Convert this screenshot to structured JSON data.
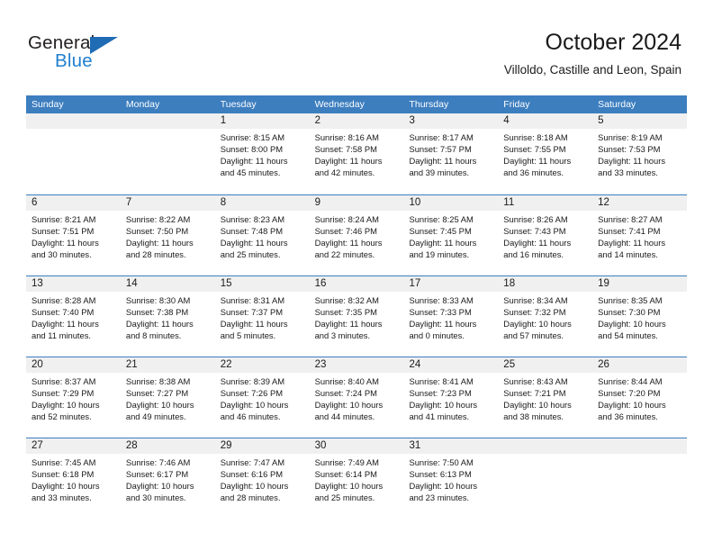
{
  "brand": {
    "name_top": "General",
    "name_bottom": "Blue",
    "triangle_color": "#1f6cb5",
    "blue_color": "#1f7fd0"
  },
  "header": {
    "title": "October 2024",
    "subtitle": "Villoldo, Castille and Leon, Spain"
  },
  "theme": {
    "header_blue": "#3d7ebf",
    "daynum_gray": "#f0f0f0",
    "text": "#1a1a1a"
  },
  "weekdays": [
    "Sunday",
    "Monday",
    "Tuesday",
    "Wednesday",
    "Thursday",
    "Friday",
    "Saturday"
  ],
  "weeks": [
    [
      {
        "day": "",
        "sunrise": "",
        "sunset": "",
        "daylight_line1": "",
        "daylight_line2": ""
      },
      {
        "day": "",
        "sunrise": "",
        "sunset": "",
        "daylight_line1": "",
        "daylight_line2": ""
      },
      {
        "day": "1",
        "sunrise": "Sunrise: 8:15 AM",
        "sunset": "Sunset: 8:00 PM",
        "daylight_line1": "Daylight: 11 hours",
        "daylight_line2": "and 45 minutes."
      },
      {
        "day": "2",
        "sunrise": "Sunrise: 8:16 AM",
        "sunset": "Sunset: 7:58 PM",
        "daylight_line1": "Daylight: 11 hours",
        "daylight_line2": "and 42 minutes."
      },
      {
        "day": "3",
        "sunrise": "Sunrise: 8:17 AM",
        "sunset": "Sunset: 7:57 PM",
        "daylight_line1": "Daylight: 11 hours",
        "daylight_line2": "and 39 minutes."
      },
      {
        "day": "4",
        "sunrise": "Sunrise: 8:18 AM",
        "sunset": "Sunset: 7:55 PM",
        "daylight_line1": "Daylight: 11 hours",
        "daylight_line2": "and 36 minutes."
      },
      {
        "day": "5",
        "sunrise": "Sunrise: 8:19 AM",
        "sunset": "Sunset: 7:53 PM",
        "daylight_line1": "Daylight: 11 hours",
        "daylight_line2": "and 33 minutes."
      }
    ],
    [
      {
        "day": "6",
        "sunrise": "Sunrise: 8:21 AM",
        "sunset": "Sunset: 7:51 PM",
        "daylight_line1": "Daylight: 11 hours",
        "daylight_line2": "and 30 minutes."
      },
      {
        "day": "7",
        "sunrise": "Sunrise: 8:22 AM",
        "sunset": "Sunset: 7:50 PM",
        "daylight_line1": "Daylight: 11 hours",
        "daylight_line2": "and 28 minutes."
      },
      {
        "day": "8",
        "sunrise": "Sunrise: 8:23 AM",
        "sunset": "Sunset: 7:48 PM",
        "daylight_line1": "Daylight: 11 hours",
        "daylight_line2": "and 25 minutes."
      },
      {
        "day": "9",
        "sunrise": "Sunrise: 8:24 AM",
        "sunset": "Sunset: 7:46 PM",
        "daylight_line1": "Daylight: 11 hours",
        "daylight_line2": "and 22 minutes."
      },
      {
        "day": "10",
        "sunrise": "Sunrise: 8:25 AM",
        "sunset": "Sunset: 7:45 PM",
        "daylight_line1": "Daylight: 11 hours",
        "daylight_line2": "and 19 minutes."
      },
      {
        "day": "11",
        "sunrise": "Sunrise: 8:26 AM",
        "sunset": "Sunset: 7:43 PM",
        "daylight_line1": "Daylight: 11 hours",
        "daylight_line2": "and 16 minutes."
      },
      {
        "day": "12",
        "sunrise": "Sunrise: 8:27 AM",
        "sunset": "Sunset: 7:41 PM",
        "daylight_line1": "Daylight: 11 hours",
        "daylight_line2": "and 14 minutes."
      }
    ],
    [
      {
        "day": "13",
        "sunrise": "Sunrise: 8:28 AM",
        "sunset": "Sunset: 7:40 PM",
        "daylight_line1": "Daylight: 11 hours",
        "daylight_line2": "and 11 minutes."
      },
      {
        "day": "14",
        "sunrise": "Sunrise: 8:30 AM",
        "sunset": "Sunset: 7:38 PM",
        "daylight_line1": "Daylight: 11 hours",
        "daylight_line2": "and 8 minutes."
      },
      {
        "day": "15",
        "sunrise": "Sunrise: 8:31 AM",
        "sunset": "Sunset: 7:37 PM",
        "daylight_line1": "Daylight: 11 hours",
        "daylight_line2": "and 5 minutes."
      },
      {
        "day": "16",
        "sunrise": "Sunrise: 8:32 AM",
        "sunset": "Sunset: 7:35 PM",
        "daylight_line1": "Daylight: 11 hours",
        "daylight_line2": "and 3 minutes."
      },
      {
        "day": "17",
        "sunrise": "Sunrise: 8:33 AM",
        "sunset": "Sunset: 7:33 PM",
        "daylight_line1": "Daylight: 11 hours",
        "daylight_line2": "and 0 minutes."
      },
      {
        "day": "18",
        "sunrise": "Sunrise: 8:34 AM",
        "sunset": "Sunset: 7:32 PM",
        "daylight_line1": "Daylight: 10 hours",
        "daylight_line2": "and 57 minutes."
      },
      {
        "day": "19",
        "sunrise": "Sunrise: 8:35 AM",
        "sunset": "Sunset: 7:30 PM",
        "daylight_line1": "Daylight: 10 hours",
        "daylight_line2": "and 54 minutes."
      }
    ],
    [
      {
        "day": "20",
        "sunrise": "Sunrise: 8:37 AM",
        "sunset": "Sunset: 7:29 PM",
        "daylight_line1": "Daylight: 10 hours",
        "daylight_line2": "and 52 minutes."
      },
      {
        "day": "21",
        "sunrise": "Sunrise: 8:38 AM",
        "sunset": "Sunset: 7:27 PM",
        "daylight_line1": "Daylight: 10 hours",
        "daylight_line2": "and 49 minutes."
      },
      {
        "day": "22",
        "sunrise": "Sunrise: 8:39 AM",
        "sunset": "Sunset: 7:26 PM",
        "daylight_line1": "Daylight: 10 hours",
        "daylight_line2": "and 46 minutes."
      },
      {
        "day": "23",
        "sunrise": "Sunrise: 8:40 AM",
        "sunset": "Sunset: 7:24 PM",
        "daylight_line1": "Daylight: 10 hours",
        "daylight_line2": "and 44 minutes."
      },
      {
        "day": "24",
        "sunrise": "Sunrise: 8:41 AM",
        "sunset": "Sunset: 7:23 PM",
        "daylight_line1": "Daylight: 10 hours",
        "daylight_line2": "and 41 minutes."
      },
      {
        "day": "25",
        "sunrise": "Sunrise: 8:43 AM",
        "sunset": "Sunset: 7:21 PM",
        "daylight_line1": "Daylight: 10 hours",
        "daylight_line2": "and 38 minutes."
      },
      {
        "day": "26",
        "sunrise": "Sunrise: 8:44 AM",
        "sunset": "Sunset: 7:20 PM",
        "daylight_line1": "Daylight: 10 hours",
        "daylight_line2": "and 36 minutes."
      }
    ],
    [
      {
        "day": "27",
        "sunrise": "Sunrise: 7:45 AM",
        "sunset": "Sunset: 6:18 PM",
        "daylight_line1": "Daylight: 10 hours",
        "daylight_line2": "and 33 minutes."
      },
      {
        "day": "28",
        "sunrise": "Sunrise: 7:46 AM",
        "sunset": "Sunset: 6:17 PM",
        "daylight_line1": "Daylight: 10 hours",
        "daylight_line2": "and 30 minutes."
      },
      {
        "day": "29",
        "sunrise": "Sunrise: 7:47 AM",
        "sunset": "Sunset: 6:16 PM",
        "daylight_line1": "Daylight: 10 hours",
        "daylight_line2": "and 28 minutes."
      },
      {
        "day": "30",
        "sunrise": "Sunrise: 7:49 AM",
        "sunset": "Sunset: 6:14 PM",
        "daylight_line1": "Daylight: 10 hours",
        "daylight_line2": "and 25 minutes."
      },
      {
        "day": "31",
        "sunrise": "Sunrise: 7:50 AM",
        "sunset": "Sunset: 6:13 PM",
        "daylight_line1": "Daylight: 10 hours",
        "daylight_line2": "and 23 minutes."
      },
      {
        "day": "",
        "sunrise": "",
        "sunset": "",
        "daylight_line1": "",
        "daylight_line2": ""
      },
      {
        "day": "",
        "sunrise": "",
        "sunset": "",
        "daylight_line1": "",
        "daylight_line2": ""
      }
    ]
  ]
}
